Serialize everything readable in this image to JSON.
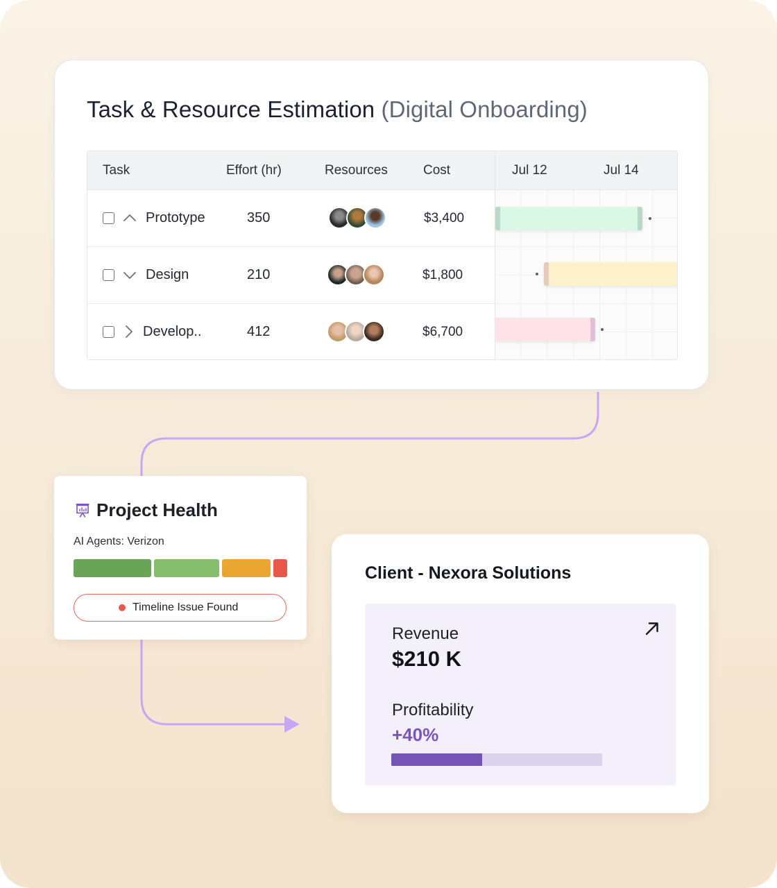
{
  "task_card": {
    "title": "Task & Resource Estimation",
    "subtitle": "(Digital Onboarding)",
    "columns": {
      "task": "Task",
      "effort": "Effort (hr)",
      "resources": "Resources",
      "cost": "Cost",
      "date_1": "Jul 12",
      "date_2": "Jul 14"
    },
    "rows": [
      {
        "name": "Prototype",
        "effort": "350",
        "cost": "$3,400",
        "chevron": "chevron-up-icon",
        "bar_color": "#daf8e6",
        "cap_color": "#bcd7c8"
      },
      {
        "name": "Design",
        "effort": "210",
        "cost": "$1,800",
        "chevron": "chevron-down-icon",
        "bar_color": "#fdf1cc",
        "cap_color": "#e3ccb8"
      },
      {
        "name": "Develop..",
        "effort": "412",
        "cost": "$6,700",
        "chevron": "chevron-right-icon",
        "bar_color": "#fde2e8",
        "cap_color": "#e0c0d6"
      }
    ]
  },
  "project_health": {
    "title": "Project Health",
    "agents_label": "AI Agents: Verizon",
    "issue_text": "Timeline Issue Found",
    "segment_colors": [
      "#6aa457",
      "#86bf6b",
      "#eba531",
      "#e85848"
    ]
  },
  "client": {
    "title": "Client - Nexora Solutions",
    "revenue_label": "Revenue",
    "revenue_value": "$210 K",
    "profitability_label": "Profitability",
    "profitability_value": "+40%",
    "profitability_fraction": 0.43
  },
  "colors": {
    "accent_purple": "#7654b6",
    "connector": "#c7a6f6"
  }
}
